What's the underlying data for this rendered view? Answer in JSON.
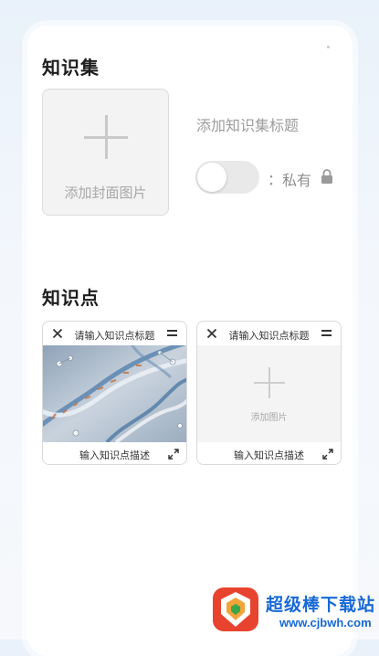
{
  "knowledge_set": {
    "section_title": "知识集",
    "cover_label": "添加封面图片",
    "title_placeholder": "添加知识集标题",
    "privacy_colon": "：",
    "privacy_label": "私有",
    "toggle_on": false
  },
  "knowledge_points": {
    "section_title": "知识点",
    "cards": [
      {
        "title_placeholder": "请输入知识点标题",
        "desc_placeholder": "输入知识点描述",
        "has_image": true
      },
      {
        "title_placeholder": "请输入知识点标题",
        "desc_placeholder": "输入知识点描述",
        "has_image": false,
        "add_image_label": "添加图片"
      }
    ]
  },
  "watermark": {
    "name": "超级棒下载站",
    "url": "www.cjbwh.com"
  },
  "colors": {
    "accent": "#1769d6",
    "placeholder_text": "#9c9c9c",
    "card_border": "#d9d9d9"
  },
  "icons": [
    "lock-icon",
    "close-icon",
    "menu-icon",
    "expand-icon",
    "plus-icon"
  ]
}
